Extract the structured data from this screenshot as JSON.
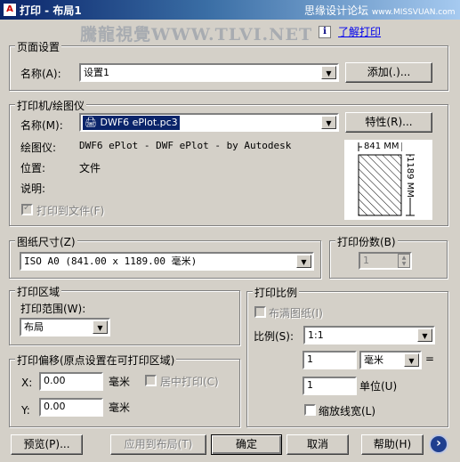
{
  "window": {
    "title": "打印 - 布局1",
    "title_icon": "A",
    "title_right": "思缘设计论坛",
    "title_right_small": "www.MISSVUAN.com",
    "watermark": "騰龍視覺WWW.TLVI.NET",
    "help_link": "了解打印",
    "info_icon": "i"
  },
  "page_setup": {
    "legend": "页面设置",
    "name_label": "名称(A):",
    "name_value": "设置1",
    "add_button": "添加(.)..."
  },
  "printer": {
    "legend": "打印机/绘图仪",
    "name_label": "名称(M):",
    "name_value": "DWF6 ePlot.pc3",
    "properties_button": "特性(R)...",
    "plotter_label": "绘图仪:",
    "plotter_value": "DWF6 ePlot - DWF ePlot - by Autodesk",
    "location_label": "位置:",
    "location_value": "文件",
    "description_label": "说明:",
    "plot_to_file_label": "打印到文件(F)",
    "plot_to_file_checked": true
  },
  "preview": {
    "width_label": "841 MM",
    "height_label": "1189 MM"
  },
  "paper_size": {
    "legend": "图纸尺寸(Z)",
    "value": "ISO A0 (841.00 x 1189.00 毫米)"
  },
  "copies": {
    "legend": "打印份数(B)",
    "value": "1"
  },
  "plot_area": {
    "legend": "打印区域",
    "range_label": "打印范围(W):",
    "range_value": "布局"
  },
  "plot_scale": {
    "legend": "打印比例",
    "fit_label": "布满图纸(I)",
    "scale_label": "比例(S):",
    "scale_value": "1:1",
    "value1": "1",
    "unit_value": "毫米",
    "equals": "=",
    "value2": "1",
    "unit_label": "单位(U)",
    "scale_lineweights_label": "缩放线宽(L)"
  },
  "plot_offset": {
    "legend": "打印偏移(原点设置在可打印区域)",
    "x_label": "X:",
    "x_value": "0.00",
    "x_unit": "毫米",
    "center_label": "居中打印(C)",
    "y_label": "Y:",
    "y_value": "0.00",
    "y_unit": "毫米"
  },
  "footer": {
    "preview_button": "预览(P)...",
    "apply_layout_button": "应用到布局(T)",
    "ok_button": "确定",
    "cancel_button": "取消",
    "help_button": "帮助(H)",
    "expand_icon": "›"
  }
}
